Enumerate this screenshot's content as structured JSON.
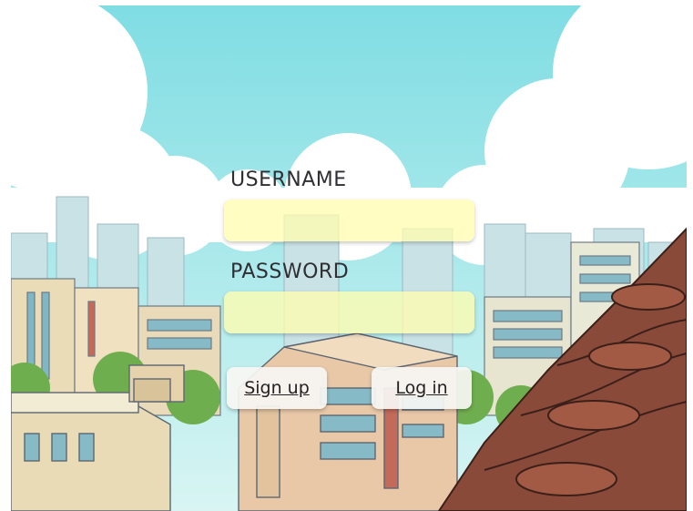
{
  "form": {
    "username_label": "USERNAME",
    "username_value": "",
    "password_label": "PASSWORD",
    "password_value": "",
    "signup_label": "Sign up",
    "login_label": "Log in"
  },
  "colors": {
    "sky": "#8fe3e6",
    "cloud": "#ffffff",
    "field_fill": "#fffcaf",
    "button_fill": "#f6f6f3",
    "roof": "#8a4a3a",
    "trees": "#6fae4e"
  },
  "background": {
    "type": "cartoon-city-skyline"
  }
}
